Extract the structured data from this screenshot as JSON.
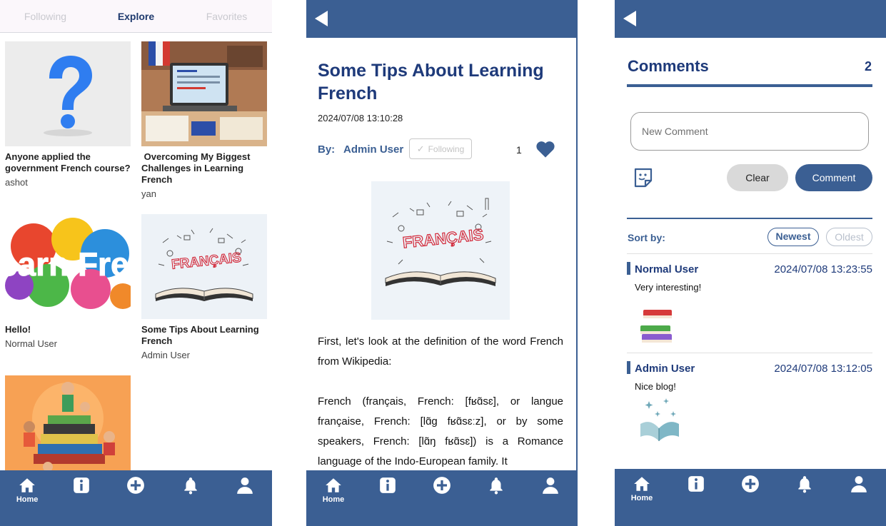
{
  "nav": {
    "home_label": "Home"
  },
  "explore": {
    "tabs": [
      "Following",
      "Explore",
      "Favorites"
    ],
    "posts": [
      {
        "title": "Anyone applied the government French course?",
        "author": "ashot"
      },
      {
        "title": " Overcoming My Biggest Challenges in Learning French",
        "author": "yan"
      },
      {
        "title": "Hello!",
        "author": "Normal User"
      },
      {
        "title": "Some Tips About Learning French",
        "author": "Admin User"
      }
    ],
    "splash_text": "earn French"
  },
  "post": {
    "title": "Some Tips About Learning French",
    "date": "2024/07/08 13:10:28",
    "by_label": "By:",
    "author": "Admin User",
    "follow_label": "Following",
    "like_count": "1",
    "image_text": "FRANÇAIS",
    "paragraph1": "First, let's look at the definition of the word French from Wikipedia:",
    "paragraph2": "French (français, French: [fʁɑ̃sɛ], or langue française, French: [lɑ̃ɡ fʁɑ̃sɛːz], or by some speakers, French: [lɑ̃ŋ fʁɑ̃sɛ]) is a Romance language of the Indo-European family. It"
  },
  "comments": {
    "title": "Comments",
    "count": "2",
    "input_placeholder": "New Comment",
    "clear_label": "Clear",
    "comment_label": "Comment",
    "sort_label": "Sort by:",
    "sort_newest": "Newest",
    "sort_oldest": "Oldest",
    "items": [
      {
        "user": "Normal User",
        "time": "2024/07/08 13:23:55",
        "text": "Very interesting!"
      },
      {
        "user": "Admin User",
        "time": "2024/07/08 13:12:05",
        "text": "Nice blog!"
      }
    ]
  },
  "colors": {
    "brand": "#3b5f93",
    "title": "#1e3a7a"
  }
}
